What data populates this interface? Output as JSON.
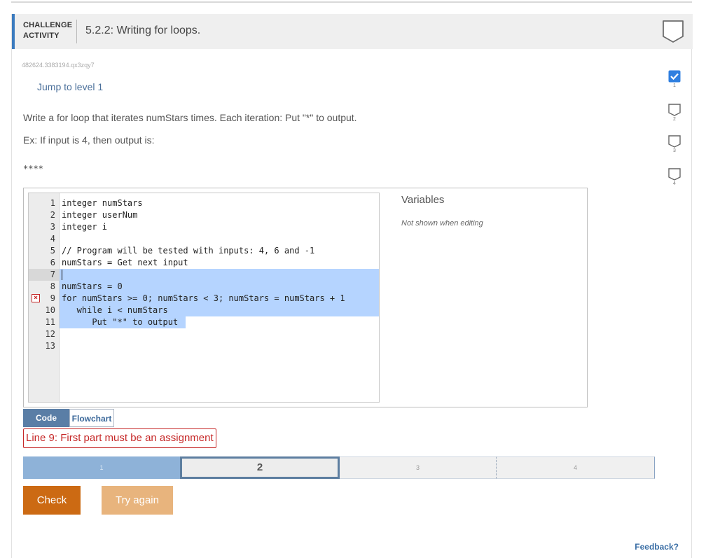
{
  "header": {
    "activity_type_line1": "CHALLENGE",
    "activity_type_line2": "ACTIVITY",
    "title": "5.2.2: Writing for loops."
  },
  "activity_id": "482624.3383194.qx3zqy7",
  "jump_link": "Jump to level 1",
  "instructions": {
    "prompt": "Write a for loop that iterates numStars times. Each iteration: Put \"*\" to output.",
    "example": "Ex: If input is 4, then output is:",
    "example_output": "****"
  },
  "code_lines": [
    {
      "n": "1",
      "text": "integer numStars"
    },
    {
      "n": "2",
      "text": "integer userNum"
    },
    {
      "n": "3",
      "text": "integer i"
    },
    {
      "n": "4",
      "text": ""
    },
    {
      "n": "5",
      "text": "// Program will be tested with inputs: 4, 6 and -1"
    },
    {
      "n": "6",
      "text": "numStars = Get next input"
    },
    {
      "n": "7",
      "text": ""
    },
    {
      "n": "8",
      "text": "numStars = 0"
    },
    {
      "n": "9",
      "text": "for numStars >= 0; numStars < 3; numStars = numStars + 1"
    },
    {
      "n": "10",
      "text": "   while i < numStars"
    },
    {
      "n": "11",
      "text": "      Put \"*\" to output"
    },
    {
      "n": "12",
      "text": ""
    },
    {
      "n": "13",
      "text": ""
    }
  ],
  "error_line": "9",
  "variables": {
    "title": "Variables",
    "note": "Not shown when editing"
  },
  "tabs": {
    "code": "Code",
    "flowchart": "Flowchart"
  },
  "error_message": "Line 9: First part must be an assignment",
  "progress": {
    "segments": [
      "1",
      "2",
      "3",
      "4"
    ],
    "current": "2"
  },
  "side_levels": [
    {
      "label": "1",
      "completed": true
    },
    {
      "label": "2",
      "completed": false
    },
    {
      "label": "3",
      "completed": false
    },
    {
      "label": "4",
      "completed": false
    }
  ],
  "buttons": {
    "check": "Check",
    "try_again": "Try again"
  },
  "feedback": "Feedback?",
  "colors": {
    "accent": "#3b7bbf",
    "check_button": "#cc6a13",
    "try_again_button": "#e8b47d",
    "error": "#c62828",
    "selection": "#b5d4ff",
    "level_complete": "#2f7fe0"
  },
  "icons": {
    "badge": "completion-badge-icon",
    "error": "error-x-icon",
    "check": "checkmark-icon"
  }
}
